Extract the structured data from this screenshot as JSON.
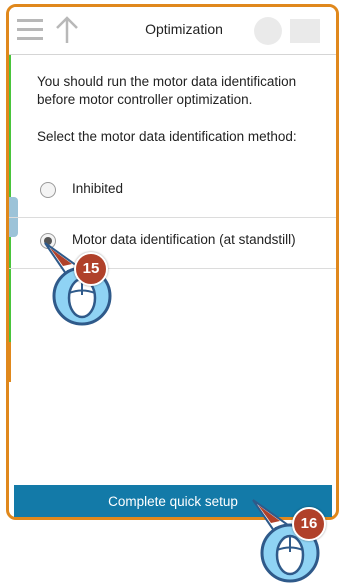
{
  "header": {
    "title": "Optimization",
    "menu_icon": "hamburger-icon",
    "back_icon": "up-arrow-icon"
  },
  "main": {
    "intro_text": "You should run the motor data identification before motor controller optimization.",
    "prompt_text": "Select the motor data identification method:",
    "options": [
      {
        "label": "Inhibited",
        "selected": false
      },
      {
        "label": "Motor data identification (at standstill)",
        "selected": true
      }
    ]
  },
  "footer": {
    "complete_button": "Complete quick setup"
  },
  "annotations": {
    "step_1": "15",
    "step_2": "16"
  },
  "colors": {
    "frame": "#e0881c",
    "button": "#137aa8",
    "badge": "#b0412a",
    "cursor_fill": "#8fd3f4",
    "cursor_outline": "#2f5a8a"
  }
}
